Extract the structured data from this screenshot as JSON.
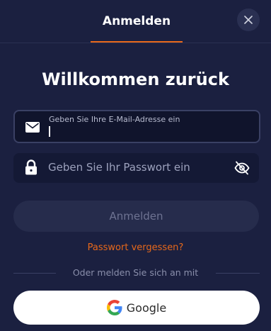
{
  "header": {
    "tab_label": "Anmelden"
  },
  "title": "Willkommen zurück",
  "email": {
    "label": "Geben Sie Ihre E-Mail-Adresse ein",
    "value": ""
  },
  "password": {
    "placeholder": "Geben Sie Ihr Passwort ein"
  },
  "submit_label": "Anmelden",
  "forgot_label": "Passwort vergessen?",
  "divider_label": "Oder melden Sie sich an mit",
  "google_label": "Google",
  "colors": {
    "accent": "#e8681a",
    "background": "#1b2040"
  },
  "icons": {
    "close": "close-icon",
    "email": "mail-icon",
    "password": "lock-icon",
    "toggle": "eye-off-icon",
    "google": "google-icon"
  }
}
